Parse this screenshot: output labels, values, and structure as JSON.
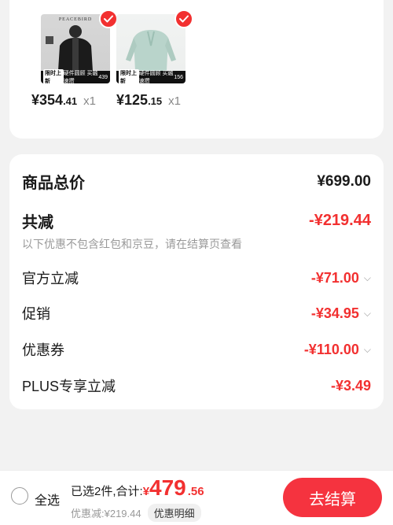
{
  "products": [
    {
      "brand": "PEACEBIRD",
      "badge_left": "限时上新",
      "badge_mid": "硬件圆顾 买融速攒",
      "badge_num": "439",
      "price_symbol": "¥",
      "price_int": "354",
      "price_dec": ".41",
      "qty": "x1"
    },
    {
      "brand": "",
      "badge_left": "限时上新",
      "badge_mid": "硬件圆顾 买融速攒",
      "badge_num": "156",
      "price_symbol": "¥",
      "price_int": "125",
      "price_dec": ".15",
      "qty": "x1"
    }
  ],
  "summary": {
    "total_label": "商品总价",
    "total_value": "¥699.00",
    "reduce_label": "共减",
    "reduce_value": "-¥219.44",
    "note": "以下优惠不包含红包和京豆，请在结算页查看",
    "lines": [
      {
        "label": "官方立减",
        "value": "-¥71.00",
        "expandable": true
      },
      {
        "label": "促销",
        "value": "-¥34.95",
        "expandable": true
      },
      {
        "label": "优惠券",
        "value": "-¥110.00",
        "expandable": true
      },
      {
        "label": "PLUS专享立减",
        "value": "-¥3.49",
        "expandable": false
      }
    ]
  },
  "bottom_bar": {
    "select_all": "全选",
    "selected_text": "已选2件,合计:",
    "total_symbol": "¥",
    "total_int": "479",
    "total_dec": ".56",
    "discount_text": "优惠减:¥219.44",
    "detail_label": "优惠明细",
    "checkout_label": "去结算"
  },
  "colors": {
    "accent": "#f23030",
    "checkout_bg": "#f5333f",
    "background": "#f2f2f2"
  },
  "icons": {
    "check": "check-icon",
    "chevron": "chevron-down-icon"
  }
}
